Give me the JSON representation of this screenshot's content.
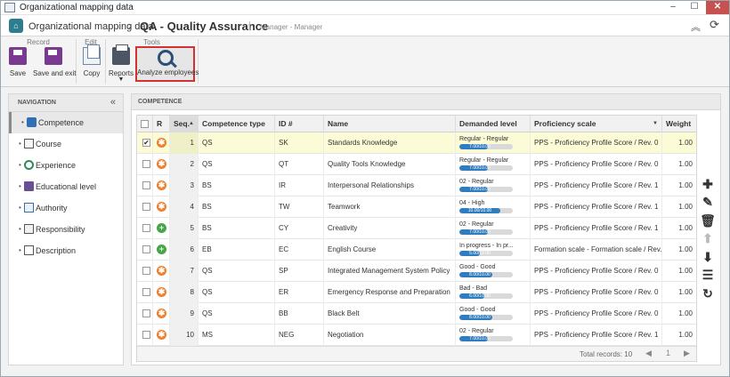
{
  "window": {
    "title": "Organizational mapping data",
    "minimize": "–",
    "maximize": "☐",
    "close": "✕"
  },
  "header": {
    "app_name": "Organizational mapping data",
    "separator": "›",
    "record": "QA - Quality Assurance",
    "pipe": "|",
    "subtitle": "Manager - Manager"
  },
  "ribbon": {
    "groups": {
      "record": "Record",
      "edit": "Edit",
      "tools": "Tools"
    },
    "save": "Save",
    "save_exit": "Save and exit",
    "copy": "Copy",
    "reports": "Reports",
    "analyze": "Analyze employees"
  },
  "nav": {
    "title": "NAVIGATION",
    "collapse": "«",
    "items": [
      {
        "label": "Competence",
        "icon": "puzzle-icon"
      },
      {
        "label": "Course",
        "icon": "course-icon"
      },
      {
        "label": "Experience",
        "icon": "clock-icon"
      },
      {
        "label": "Educational level",
        "icon": "education-icon"
      },
      {
        "label": "Authority",
        "icon": "authority-icon"
      },
      {
        "label": "Responsibility",
        "icon": "responsibility-icon"
      },
      {
        "label": "Description",
        "icon": "document-icon"
      }
    ]
  },
  "main": {
    "title": "COMPETENCE",
    "columns": {
      "r": "R",
      "seq": "Seq.",
      "type": "Competence type",
      "id": "ID #",
      "name": "Name",
      "level": "Demanded level",
      "scale": "Proficiency scale",
      "weight": "Weight"
    },
    "rows": [
      {
        "checked": true,
        "r": "orange",
        "seq": "1",
        "type": "QS",
        "id": "SK",
        "name": "Standards Knowledge",
        "level_text": "Regular - Regular",
        "level_value": "7.00/10.00",
        "level_pct": 0.7,
        "scale": "PPS - Proficiency Profile Score / Rev. 0",
        "weight": "1.00"
      },
      {
        "checked": false,
        "r": "orange",
        "seq": "2",
        "type": "QS",
        "id": "QT",
        "name": "Quality Tools Knowledge",
        "level_text": "Regular - Regular",
        "level_value": "7.00/10.00",
        "level_pct": 0.7,
        "scale": "PPS - Proficiency Profile Score / Rev. 0",
        "weight": "1.00"
      },
      {
        "checked": false,
        "r": "orange",
        "seq": "3",
        "type": "BS",
        "id": "IR",
        "name": "Interpersonal Relationships",
        "level_text": "02 - Regular",
        "level_value": "7.00/10.00",
        "level_pct": 0.7,
        "scale": "PPS - Proficiency Profile Score / Rev. 1",
        "weight": "1.00"
      },
      {
        "checked": false,
        "r": "orange",
        "seq": "4",
        "type": "BS",
        "id": "TW",
        "name": "Teamwork",
        "level_text": "04 - High",
        "level_value": "10.00/10.00",
        "level_pct": 1.0,
        "scale": "PPS - Proficiency Profile Score / Rev. 1",
        "weight": "1.00"
      },
      {
        "checked": false,
        "r": "green",
        "seq": "5",
        "type": "BS",
        "id": "CY",
        "name": "Creativity",
        "level_text": "02 - Regular",
        "level_value": "7.00/10.00",
        "level_pct": 0.7,
        "scale": "PPS - Proficiency Profile Score / Rev. 1",
        "weight": "1.00"
      },
      {
        "checked": false,
        "r": "green",
        "seq": "6",
        "type": "EB",
        "id": "EC",
        "name": "English Course",
        "level_text": "In progress - In pr...",
        "level_value": "5.00/10.00",
        "level_pct": 0.5,
        "scale": "Formation scale - Formation scale / Rev. 0",
        "weight": "1.00"
      },
      {
        "checked": false,
        "r": "orange",
        "seq": "7",
        "type": "QS",
        "id": "SP",
        "name": "Integrated Management System Policy",
        "level_text": "Good - Good",
        "level_value": "8.00/10.00",
        "level_pct": 0.8,
        "scale": "PPS - Proficiency Profile Score / Rev. 0",
        "weight": "1.00"
      },
      {
        "checked": false,
        "r": "orange",
        "seq": "8",
        "type": "QS",
        "id": "ER",
        "name": "Emergency Response and Preparation",
        "level_text": "Bad - Bad",
        "level_value": "6.00/10.00",
        "level_pct": 0.6,
        "scale": "PPS - Proficiency Profile Score / Rev. 0",
        "weight": "1.00"
      },
      {
        "checked": false,
        "r": "orange",
        "seq": "9",
        "type": "QS",
        "id": "BB",
        "name": "Black Belt",
        "level_text": "Good - Good",
        "level_value": "8.00/10.00",
        "level_pct": 0.8,
        "scale": "PPS - Proficiency Profile Score / Rev. 0",
        "weight": "1.00"
      },
      {
        "checked": false,
        "r": "orange",
        "seq": "10",
        "type": "MS",
        "id": "NEG",
        "name": "Negotiation",
        "level_text": "02 - Regular",
        "level_value": "7.00/10.00",
        "level_pct": 0.7,
        "scale": "PPS - Proficiency Profile Score / Rev. 1",
        "weight": "1.00"
      }
    ],
    "footer": {
      "total": "Total records: 10",
      "page_num": "1"
    }
  },
  "colors": {
    "accent": "#2f7dbf",
    "highlight": "#d13333",
    "status_orange": "#ee7f2d",
    "status_green": "#46a546",
    "selected_row": "#fbfbd6"
  }
}
